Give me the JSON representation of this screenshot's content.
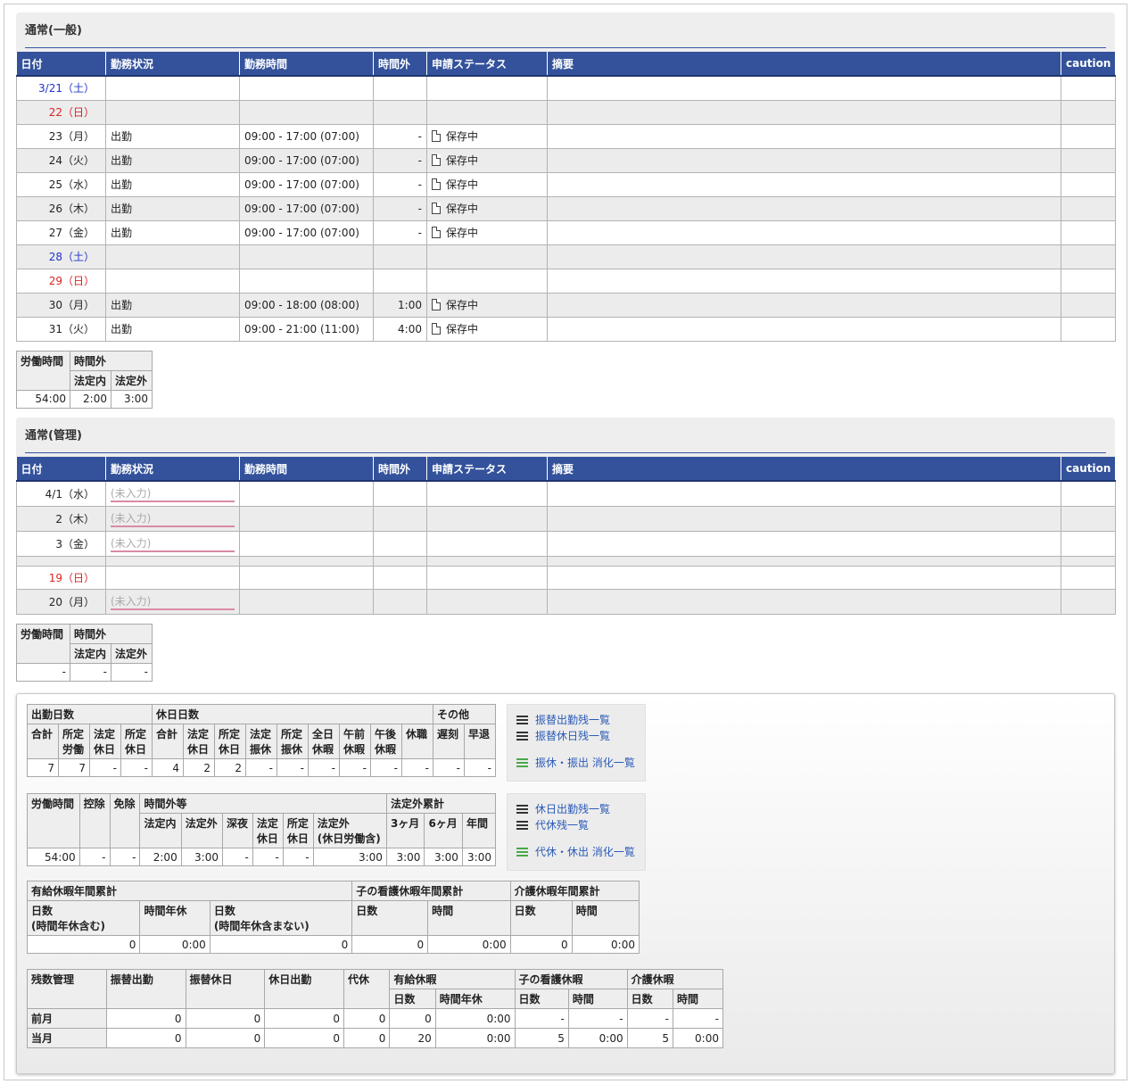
{
  "headers": [
    "日付",
    "勤務状況",
    "勤務時間",
    "時間外",
    "申請ステータス",
    "摘要",
    "caution"
  ],
  "section1": {
    "title": "通常(一般)",
    "rows": [
      {
        "date": "3/21（土）",
        "color": "blue",
        "status": "",
        "time": "",
        "ot": "",
        "app": "",
        "alt": false
      },
      {
        "date": "22（日）",
        "color": "red",
        "status": "",
        "time": "",
        "ot": "",
        "app": "",
        "alt": true
      },
      {
        "date": "23（月）",
        "color": "",
        "status": "出勤",
        "time": "09:00 - 17:00 (07:00)",
        "ot": "-",
        "app": "保存中",
        "alt": false
      },
      {
        "date": "24（火）",
        "color": "",
        "status": "出勤",
        "time": "09:00 - 17:00 (07:00)",
        "ot": "-",
        "app": "保存中",
        "alt": true
      },
      {
        "date": "25（水）",
        "color": "",
        "status": "出勤",
        "time": "09:00 - 17:00 (07:00)",
        "ot": "-",
        "app": "保存中",
        "alt": false
      },
      {
        "date": "26（木）",
        "color": "",
        "status": "出勤",
        "time": "09:00 - 17:00 (07:00)",
        "ot": "-",
        "app": "保存中",
        "alt": true
      },
      {
        "date": "27（金）",
        "color": "",
        "status": "出勤",
        "time": "09:00 - 17:00 (07:00)",
        "ot": "-",
        "app": "保存中",
        "alt": false
      },
      {
        "date": "28（土）",
        "color": "blue",
        "status": "",
        "time": "",
        "ot": "",
        "app": "",
        "alt": true
      },
      {
        "date": "29（日）",
        "color": "red",
        "status": "",
        "time": "",
        "ot": "",
        "app": "",
        "alt": false
      },
      {
        "date": "30（月）",
        "color": "",
        "status": "出勤",
        "time": "09:00 - 18:00 (08:00)",
        "ot": "1:00",
        "app": "保存中",
        "alt": true
      },
      {
        "date": "31（火）",
        "color": "",
        "status": "出勤",
        "time": "09:00 - 21:00 (11:00)",
        "ot": "4:00",
        "app": "保存中",
        "alt": false
      }
    ],
    "summary": {
      "labor": "労働時間",
      "ot": "時間外",
      "in": "法定内",
      "out": "法定外",
      "v_labor": "54:00",
      "v_in": "2:00",
      "v_out": "3:00"
    }
  },
  "section2": {
    "title": "通常(管理)",
    "rows": [
      {
        "date": "4/1（水）",
        "color": "",
        "status": "(未入力)",
        "alt": false
      },
      {
        "date": "2（木）",
        "color": "",
        "status": "(未入力)",
        "alt": true
      },
      {
        "date": "3（金）",
        "color": "",
        "status": "(未入力)",
        "alt": false
      },
      {
        "date": "19（日）",
        "color": "red",
        "status": "",
        "alt": false
      },
      {
        "date": "20（月）",
        "color": "",
        "status": "(未入力)",
        "alt": true
      }
    ],
    "summary": {
      "labor": "労働時間",
      "ot": "時間外",
      "in": "法定内",
      "out": "法定外",
      "v_labor": "-",
      "v_in": "-",
      "v_out": "-"
    }
  },
  "t1": {
    "h_work": "出勤日数",
    "h_hol": "休日日数",
    "h_other": "その他",
    "cols": [
      "合計",
      "所定\n労働",
      "法定\n休日",
      "所定\n休日",
      "合計",
      "法定\n休日",
      "所定\n休日",
      "法定\n振休",
      "所定\n振休",
      "全日\n休暇",
      "午前\n休暇",
      "午後\n休暇",
      "休職",
      "遅刻",
      "早退"
    ],
    "vals": [
      "7",
      "7",
      "-",
      "-",
      "4",
      "2",
      "2",
      "-",
      "-",
      "-",
      "-",
      "-",
      "-",
      "-",
      "-"
    ]
  },
  "t2": {
    "labor": "労働時間",
    "deduct": "控除",
    "exempt": "免除",
    "ote": "時間外等",
    "cum": "法定外累計",
    "cols": [
      "法定内",
      "法定外",
      "深夜",
      "法定\n休日",
      "所定\n休日",
      "法定外\n(休日労働含)",
      "3ヶ月",
      "6ヶ月",
      "年間"
    ],
    "vals": [
      "54:00",
      "-",
      "-",
      "2:00",
      "3:00",
      "-",
      "-",
      "-",
      "3:00",
      "3:00",
      "3:00",
      "3:00"
    ]
  },
  "t3": {
    "h1": "有給休暇年間累計",
    "h2": "子の看護休暇年間累計",
    "h3": "介護休暇年間累計",
    "cols": [
      "日数\n(時間年休含む)",
      "時間年休",
      "日数\n(時間年休含まない)",
      "日数",
      "時間",
      "日数",
      "時間"
    ],
    "vals": [
      "0",
      "0:00",
      "0",
      "0",
      "0:00",
      "0",
      "0:00"
    ]
  },
  "t4": {
    "mgmt": "残数管理",
    "c1": "振替出勤",
    "c2": "振替休日",
    "c3": "休日出勤",
    "c4": "代休",
    "paid": "有給休暇",
    "child": "子の看護休暇",
    "care": "介護休暇",
    "sub": [
      "日数",
      "時間年休",
      "日数",
      "時間",
      "日数",
      "時間"
    ],
    "rows": [
      {
        "label": "前月",
        "vals": [
          "0",
          "0",
          "0",
          "0",
          "0",
          "0:00",
          "-",
          "-",
          "-",
          "-"
        ]
      },
      {
        "label": "当月",
        "vals": [
          "0",
          "0",
          "0",
          "0",
          "20",
          "0:00",
          "5",
          "0:00",
          "5",
          "0:00"
        ]
      }
    ]
  },
  "links1": [
    "振替出勤残一覧",
    "振替休日残一覧",
    "振休・振出 消化一覧"
  ],
  "links2": [
    "休日出勤残一覧",
    "代休残一覧",
    "代休・休出 消化一覧"
  ]
}
